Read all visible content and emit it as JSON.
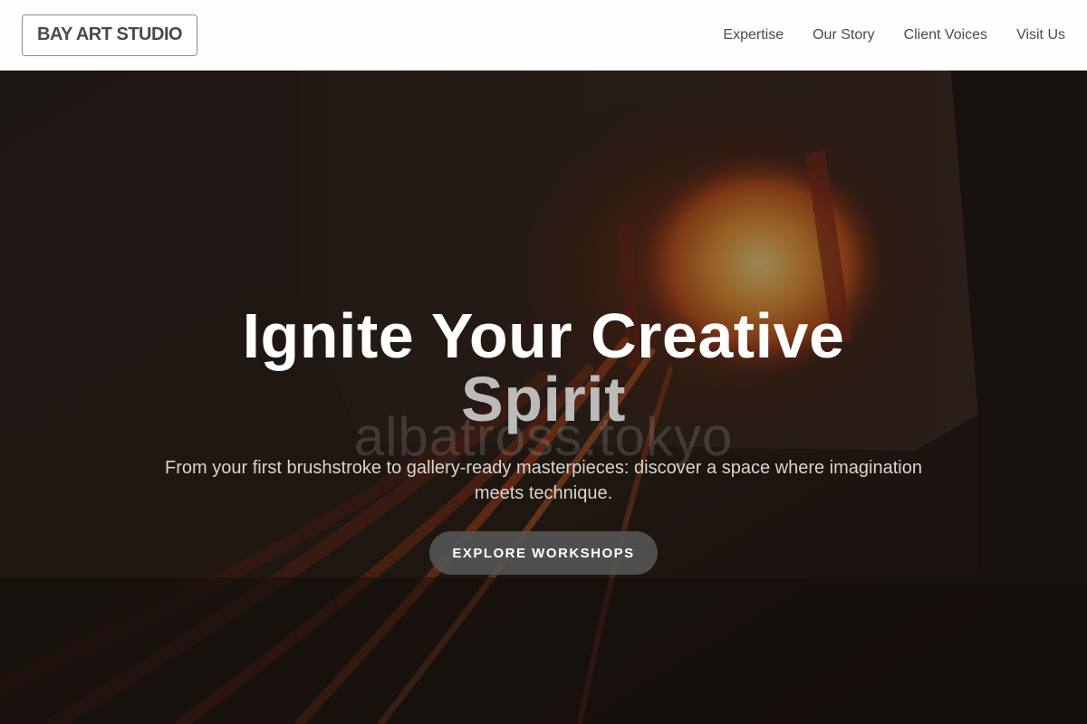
{
  "header": {
    "logo": "BAY ART STUDIO",
    "nav": [
      {
        "label": "Expertise"
      },
      {
        "label": "Our Story"
      },
      {
        "label": "Client Voices"
      },
      {
        "label": "Visit Us"
      }
    ]
  },
  "hero": {
    "title_line1": "Ignite Your Creative",
    "title_line2": "Spirit",
    "watermark": "albatross.tokyo",
    "subtitle": "From your first brushstroke to gallery-ready masterpieces: discover a space where imagination meets technique.",
    "cta_label": "EXPLORE WORKSHOPS"
  },
  "colors": {
    "header_bg": "#fefefe",
    "logo_text": "#4a4a4a",
    "nav_text": "#4b4b4b",
    "hero_title": "#ffffff",
    "hero_title_accent": "#bdbbb9",
    "cta_bg": "#545454",
    "furnace_glow": "#f29a2e"
  }
}
